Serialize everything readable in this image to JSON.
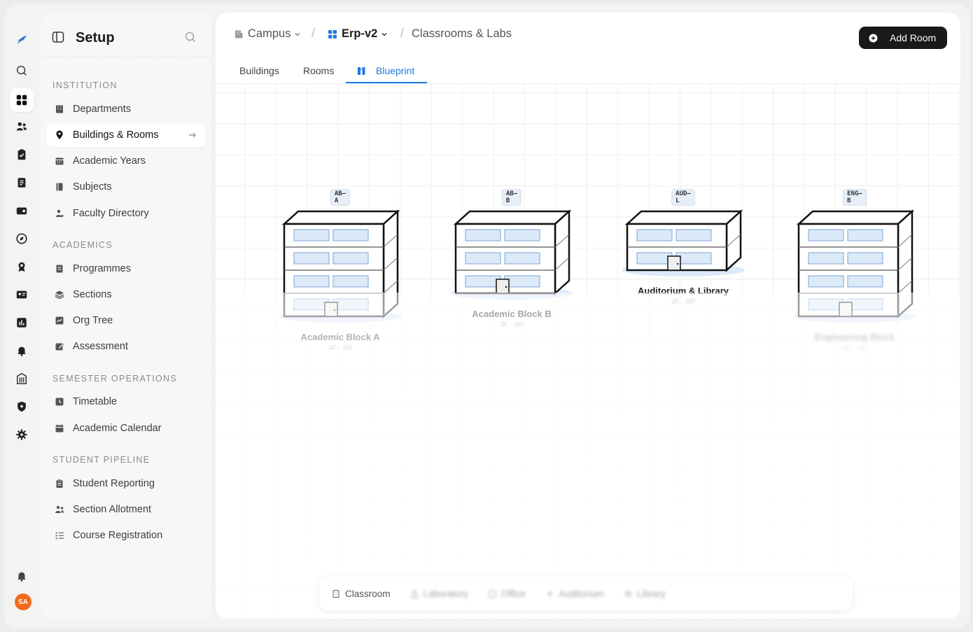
{
  "sidebar": {
    "title": "Setup",
    "sections": [
      {
        "label": "INSTITUTION"
      },
      {
        "label": "ACADEMICS"
      },
      {
        "label": "SEMESTER OPERATIONS"
      },
      {
        "label": "STUDENT PIPELINE"
      }
    ],
    "items": [
      {
        "label": "Departments",
        "icon": "building-icon"
      },
      {
        "label": "Buildings & Rooms",
        "icon": "map-pin-icon",
        "active": true
      },
      {
        "label": "Academic Years",
        "icon": "calendar-icon"
      },
      {
        "label": "Subjects",
        "icon": "book-icon"
      },
      {
        "label": "Faculty Directory",
        "icon": "user-icon"
      },
      {
        "label": "Programmes",
        "icon": "list-icon"
      },
      {
        "label": "Sections",
        "icon": "layers-icon"
      },
      {
        "label": "Org Tree",
        "icon": "tree-icon"
      },
      {
        "label": "Assessment",
        "icon": "edit-icon"
      },
      {
        "label": "Timetable",
        "icon": "clock-icon"
      },
      {
        "label": "Academic Calendar",
        "icon": "calendar-icon"
      },
      {
        "label": "Student Reporting",
        "icon": "clipboard-icon"
      },
      {
        "label": "Section Allotment",
        "icon": "users-icon"
      },
      {
        "label": "Course Registration",
        "icon": "checklist-icon"
      }
    ]
  },
  "header": {
    "crumb_campus": "Campus",
    "crumb_project": "Erp-v2",
    "crumb_page": "Classrooms & Labs",
    "add_button": "Add Room"
  },
  "tabs": [
    {
      "label": "Buildings"
    },
    {
      "label": "Rooms"
    },
    {
      "label": "Blueprint",
      "active": true
    }
  ],
  "buildings": [
    {
      "code": "AB–A",
      "name": "Academic Block A",
      "meta": "4F · 8R",
      "floors": 4
    },
    {
      "code": "AB–B",
      "name": "Academic Block B",
      "meta": "3F · 8R",
      "floors": 3
    },
    {
      "code": "AUD–L",
      "name": "Auditorium & Library",
      "meta": "2F · 8R",
      "floors": 2
    },
    {
      "code": "ENG–B",
      "name": "Engineering Block",
      "meta": "4F · 8R",
      "floors": 4
    }
  ],
  "legend": [
    {
      "label": "Classroom",
      "icon": "building-icon"
    },
    {
      "label": "Laboratory",
      "icon": "flask-icon"
    },
    {
      "label": "Office",
      "icon": "office-icon"
    },
    {
      "label": "Auditorium",
      "icon": "auditorium-icon"
    },
    {
      "label": "Library",
      "icon": "library-icon"
    }
  ],
  "colors": {
    "accent": "#1f7ae0",
    "avatar": "#f26a1b",
    "window": "#dbe9f8"
  },
  "user": {
    "initials": "SA"
  }
}
